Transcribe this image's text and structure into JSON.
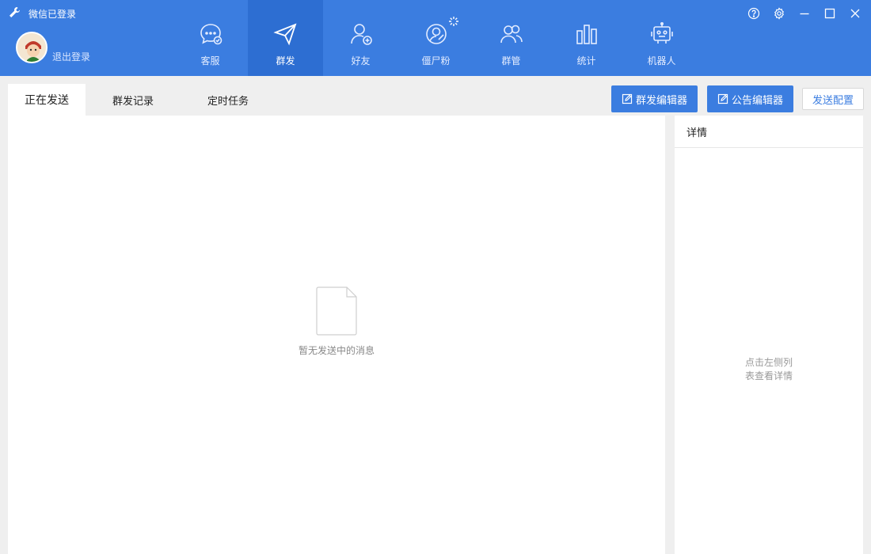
{
  "app": {
    "title": "微信已登录",
    "logout_label": "退出登录"
  },
  "nav": {
    "items": [
      {
        "label": "客服",
        "icon": "chat-icon"
      },
      {
        "label": "群发",
        "icon": "paper-plane-icon"
      },
      {
        "label": "好友",
        "icon": "add-friend-icon"
      },
      {
        "label": "僵尸粉",
        "icon": "zombie-fan-icon"
      },
      {
        "label": "群管",
        "icon": "group-manage-icon"
      },
      {
        "label": "统计",
        "icon": "bar-chart-icon"
      },
      {
        "label": "机器人",
        "icon": "robot-icon"
      }
    ],
    "active": "群发"
  },
  "window_controls": [
    "help-icon",
    "settings-icon",
    "minimize-icon",
    "maximize-icon",
    "close-icon"
  ],
  "tabs": [
    {
      "label": "正在发送"
    },
    {
      "label": "群发记录"
    },
    {
      "label": "定时任务"
    }
  ],
  "toolbar": {
    "mass_editor_label": "群发编辑器",
    "notice_editor_label": "公告编辑器",
    "send_config_label": "发送配置"
  },
  "main": {
    "empty_text": "暂无发送中的消息"
  },
  "detail": {
    "title": "详情",
    "hint_line1": "点击左侧列",
    "hint_line2": "表查看详情"
  },
  "colors": {
    "primary": "#3b7de0",
    "active_nav": "#2d6ed2",
    "background": "#efefef"
  }
}
